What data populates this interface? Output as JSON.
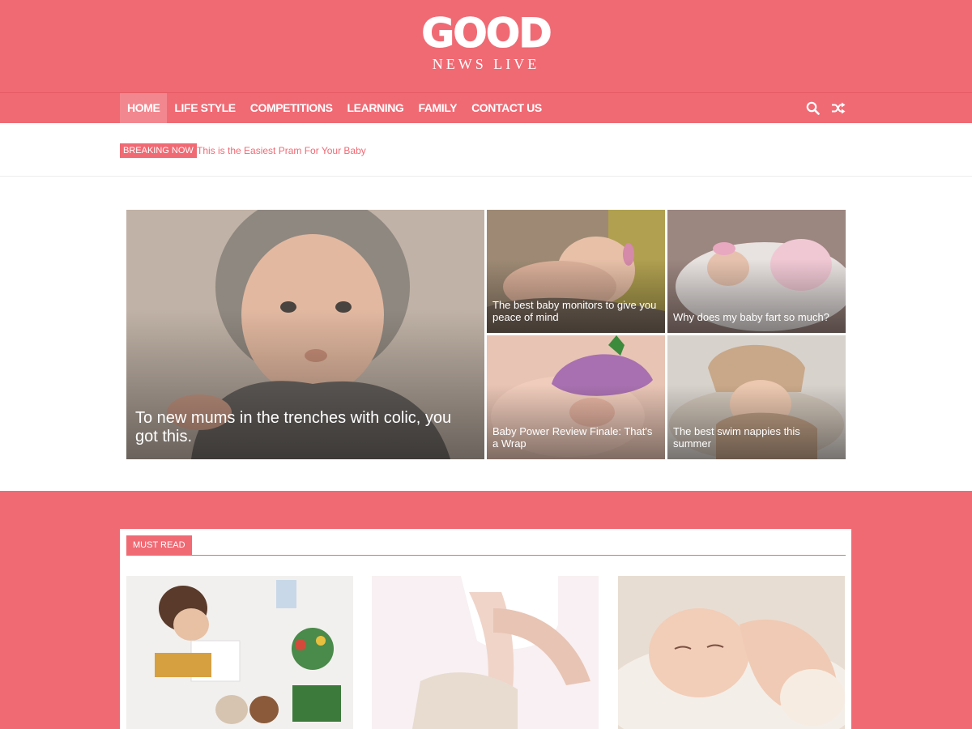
{
  "site": {
    "logo_main": "GOOD",
    "logo_sub": "NEWS LIVE",
    "brand_color": "#f06a74"
  },
  "nav": {
    "items": [
      {
        "label": "HOME",
        "active": true
      },
      {
        "label": "LIFE STYLE"
      },
      {
        "label": "COMPETITIONS"
      },
      {
        "label": "LEARNING"
      },
      {
        "label": "FAMILY"
      },
      {
        "label": "CONTACT US"
      }
    ],
    "icons": [
      "search-icon",
      "shuffle-icon"
    ]
  },
  "ticker": {
    "badge": "BREAKING NOW",
    "headline": "This is the Easiest Pram For Your Baby"
  },
  "featured": {
    "main": {
      "title": "To new mums in the trenches with colic, you got this."
    },
    "grid": [
      {
        "title": "The best baby monitors to give you peace of mind"
      },
      {
        "title": "Why does my baby fart so much?"
      },
      {
        "title": "Baby Power Review Finale: That's a Wrap"
      },
      {
        "title": "The best swim nappies this summer"
      }
    ]
  },
  "must_read": {
    "label": "MUST READ"
  }
}
